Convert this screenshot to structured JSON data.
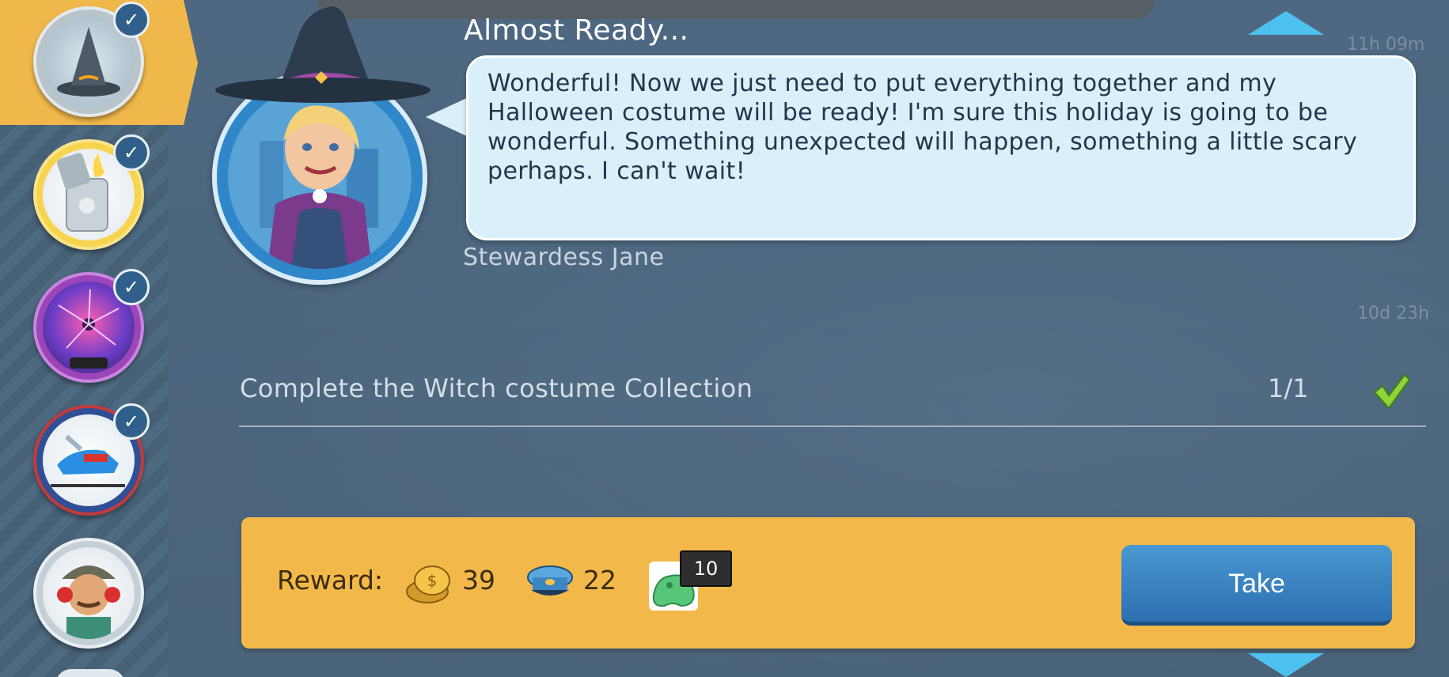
{
  "title": "Almost Ready...",
  "dialog": {
    "text": "Wonderful! Now we just need to put everything together and my Halloween costume will be ready! I'm sure this holiday is going to be wonderful. Something unexpected will happen, something a little scary perhaps. I can't wait!",
    "speaker": "Stewardess Jane"
  },
  "task": {
    "description": "Complete the Witch costume Collection",
    "progress": "1/1",
    "completed": true
  },
  "reward": {
    "label": "Reward:",
    "items": [
      {
        "icon": "coins-icon",
        "value": "39"
      },
      {
        "icon": "pilot-cap-icon",
        "value": "22"
      },
      {
        "icon": "green-slime-icon",
        "value": "10"
      }
    ],
    "take_label": "Take"
  },
  "sidebar": {
    "items": [
      {
        "icon": "witch-hat-icon",
        "completed": true,
        "active": true
      },
      {
        "icon": "lighter-icon",
        "completed": true
      },
      {
        "icon": "plasma-ball-icon",
        "completed": true
      },
      {
        "icon": "snowmobile-icon",
        "completed": true
      },
      {
        "icon": "ground-crew-avatar-icon",
        "completed": false
      }
    ]
  },
  "background_timers": [
    "11h 09m",
    "10d 23h"
  ],
  "colors": {
    "panel": "#f2b94a",
    "button": "#2c6fb0",
    "bubble": "#d9f0fb",
    "accent_arrow": "#4fc1f0"
  }
}
